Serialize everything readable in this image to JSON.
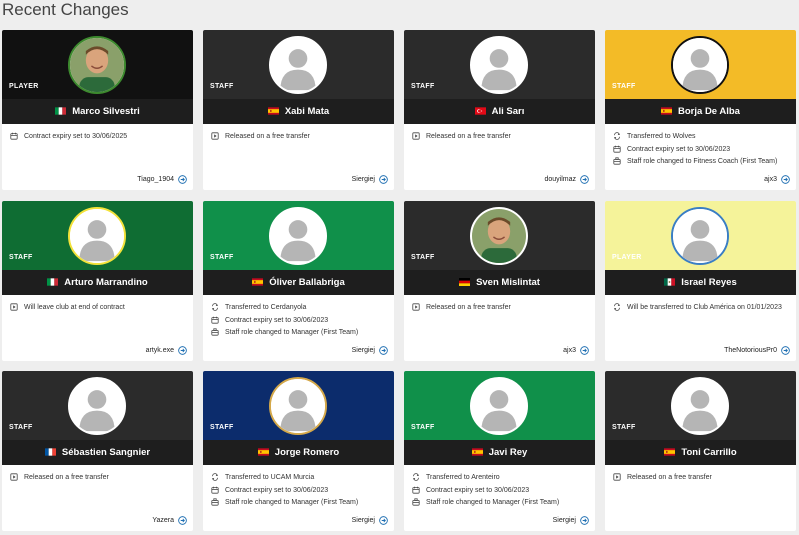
{
  "page_title": "Recent Changes",
  "colors": {
    "black": "#111111",
    "dark": "#2b2b2b",
    "yellow": "#f3bb27",
    "green_dark": "#0f6d33",
    "green": "#10904a",
    "paleyellow": "#f5f39a",
    "navy": "#0c2c6c",
    "bar": "#1e1e1e",
    "link": "#1f6fb2"
  },
  "icons": {
    "contract": "calendar-icon",
    "release": "release-icon",
    "transfer": "transfer-icon",
    "staff_role": "briefcase-icon",
    "leave": "release-icon",
    "user_link": "arrow-right-circle-icon"
  },
  "cards": [
    {
      "role": "PLAYER",
      "name": "Marco Silvestri",
      "flag": "italy-flag",
      "bg": "black",
      "photo": true,
      "ring": "green",
      "changes": [
        {
          "icon": "contract",
          "text": "Contract expiry set to 30/06/2025"
        }
      ],
      "user": "Tiago_1904"
    },
    {
      "role": "STAFF",
      "name": "Xabi Mata",
      "flag": "spain-flag",
      "bg": "dark",
      "changes": [
        {
          "icon": "release",
          "text": "Released on a free transfer"
        }
      ],
      "user": "Siergiej"
    },
    {
      "role": "STAFF",
      "name": "Ali Sarı",
      "flag": "turkey-flag",
      "bg": "dark",
      "changes": [
        {
          "icon": "release",
          "text": "Released on a free transfer"
        }
      ],
      "user": "douyilmaz"
    },
    {
      "role": "STAFF",
      "name": "Borja De Alba",
      "flag": "spain-flag",
      "bg": "yellow",
      "ring": "black",
      "changes": [
        {
          "icon": "transfer",
          "text": "Transferred to Wolves"
        },
        {
          "icon": "contract",
          "text": "Contract expiry set to 30/06/2023"
        },
        {
          "icon": "staff_role",
          "text": "Staff role changed to Fitness Coach (First Team)"
        }
      ],
      "user": "ajx3"
    },
    {
      "role": "STAFF",
      "name": "Arturo Marrandino",
      "flag": "italy-flag",
      "bg": "green_dark",
      "ring": "yellow",
      "changes": [
        {
          "icon": "leave",
          "text": "Will leave club at end of contract"
        }
      ],
      "user": "artyk.exe"
    },
    {
      "role": "STAFF",
      "name": "Óliver Ballabriga",
      "flag": "spain-flag",
      "bg": "green",
      "changes": [
        {
          "icon": "transfer",
          "text": "Transferred to Cerdanyola"
        },
        {
          "icon": "contract",
          "text": "Contract expiry set to 30/06/2023"
        },
        {
          "icon": "staff_role",
          "text": "Staff role changed to Manager (First Team)"
        }
      ],
      "user": "Siergiej"
    },
    {
      "role": "STAFF",
      "name": "Sven Mislintat",
      "flag": "germany-flag",
      "bg": "dark",
      "photo": true,
      "changes": [
        {
          "icon": "release",
          "text": "Released on a free transfer"
        }
      ],
      "user": "ajx3"
    },
    {
      "role": "PLAYER",
      "name": "Israel Reyes",
      "flag": "mexico-flag",
      "bg": "paleyellow",
      "ring": "blue",
      "changes": [
        {
          "icon": "transfer",
          "text": "Will be transferred to Club América on 01/01/2023"
        }
      ],
      "user": "TheNotoriousPr0"
    },
    {
      "role": "STAFF",
      "name": "Sébastien Sangnier",
      "flag": "france-flag",
      "bg": "dark",
      "changes": [
        {
          "icon": "release",
          "text": "Released on a free transfer"
        }
      ],
      "user": "Yazera"
    },
    {
      "role": "STAFF",
      "name": "Jorge Romero",
      "flag": "spain-flag",
      "bg": "navy",
      "ring": "gold",
      "changes": [
        {
          "icon": "transfer",
          "text": "Transferred to UCAM Murcia"
        },
        {
          "icon": "contract",
          "text": "Contract expiry set to 30/06/2023"
        },
        {
          "icon": "staff_role",
          "text": "Staff role changed to Manager (First Team)"
        }
      ],
      "user": "Siergiej"
    },
    {
      "role": "STAFF",
      "name": "Javi Rey",
      "flag": "spain-flag",
      "bg": "green",
      "changes": [
        {
          "icon": "transfer",
          "text": "Transferred to Arenteiro"
        },
        {
          "icon": "contract",
          "text": "Contract expiry set to 30/06/2023"
        },
        {
          "icon": "staff_role",
          "text": "Staff role changed to Manager (First Team)"
        }
      ],
      "user": "Siergiej"
    },
    {
      "role": "STAFF",
      "name": "Toni Carrillo",
      "flag": "spain-flag",
      "bg": "dark",
      "changes": [
        {
          "icon": "release",
          "text": "Released on a free transfer"
        }
      ],
      "user": ""
    }
  ]
}
